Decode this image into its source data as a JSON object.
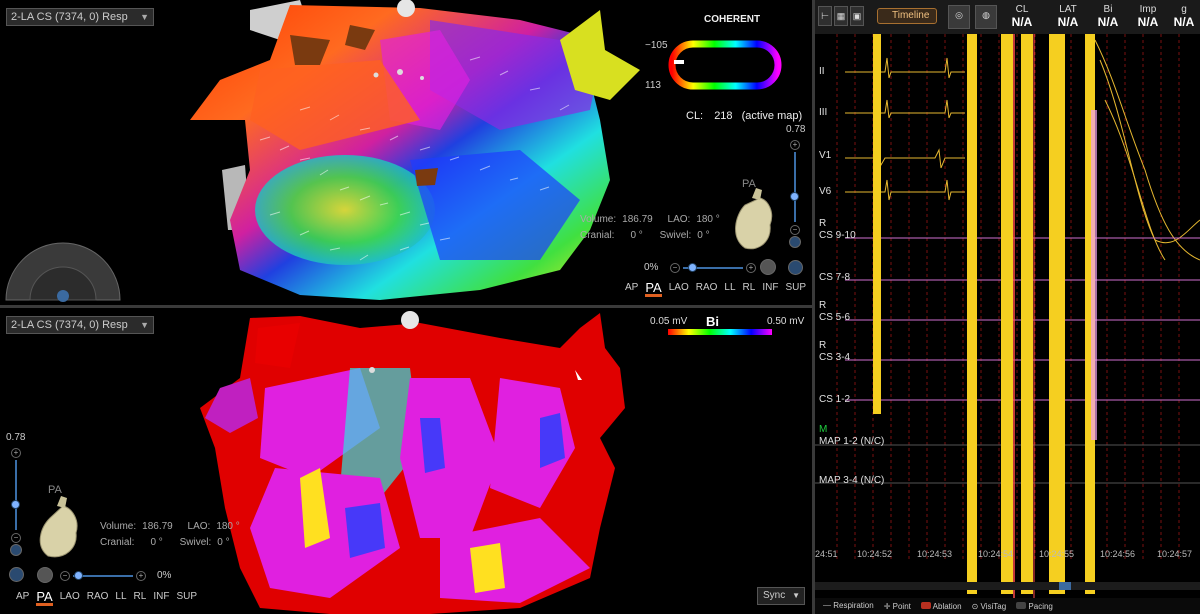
{
  "top_pane": {
    "map_selector": "2-LA CS (7374, 0) Resp",
    "mode_label": "COHERENT",
    "scale_min": "−105",
    "scale_max": "113",
    "cl_label": "CL:",
    "cl_value": "218",
    "cl_note": "(active map)",
    "opacity": "0.78",
    "orientation_label": "PA",
    "volume_label": "Volume:",
    "volume_value": "186.79",
    "lao_label": "LAO:",
    "lao_value": "180 °",
    "cranial_label": "Cranial:",
    "cranial_value": "0 °",
    "swivel_label": "Swivel:",
    "swivel_value": "0 °",
    "transparency": "0%",
    "views": [
      "AP",
      "PA",
      "LAO",
      "RAO",
      "LL",
      "RL",
      "INF",
      "SUP"
    ]
  },
  "bottom_pane": {
    "map_selector": "2-LA CS (7374, 0) Resp",
    "scale_min": "0.05 mV",
    "scale_label": "Bi",
    "scale_max": "0.50 mV",
    "opacity": "0.78",
    "orientation_label": "PA",
    "volume_label": "Volume:",
    "volume_value": "186.79",
    "lao_label": "LAO:",
    "lao_value": "180 °",
    "cranial_label": "Cranial:",
    "cranial_value": "0 °",
    "swivel_label": "Swivel:",
    "swivel_value": "0 °",
    "transparency": "0%",
    "views": [
      "AP",
      "PA",
      "LAO",
      "RAO",
      "LL",
      "RL",
      "INF",
      "SUP"
    ],
    "sync": "Sync"
  },
  "egm": {
    "timeline": "Timeline",
    "metrics": [
      {
        "label": "CL",
        "value": "N/A"
      },
      {
        "label": "LAT",
        "value": "N/A"
      },
      {
        "label": "Bi",
        "value": "N/A"
      },
      {
        "label": "Imp",
        "value": "N/A"
      },
      {
        "label": "g",
        "value": "N/A"
      }
    ],
    "channels": [
      "II",
      "III",
      "V1",
      "V6",
      "R",
      "CS 9-10",
      "CS 7-8",
      "R",
      "CS 5-6",
      "R",
      "CS 3-4",
      "CS 1-2",
      "M",
      "MAP 1-2 (N/C)",
      "MAP 3-4 (N/C)"
    ],
    "times": [
      "24:51",
      "10:24:52",
      "10:24:53",
      "10:24:54",
      "10:24:55",
      "10:24:56",
      "10:24:57"
    ],
    "legend": [
      "Respiration",
      "Point",
      "Ablation",
      "VisiTag",
      "Pacing"
    ],
    "colors": {
      "surface": "#e6b830",
      "cs": "#d070d0",
      "ablation": "#f5cf20"
    }
  }
}
